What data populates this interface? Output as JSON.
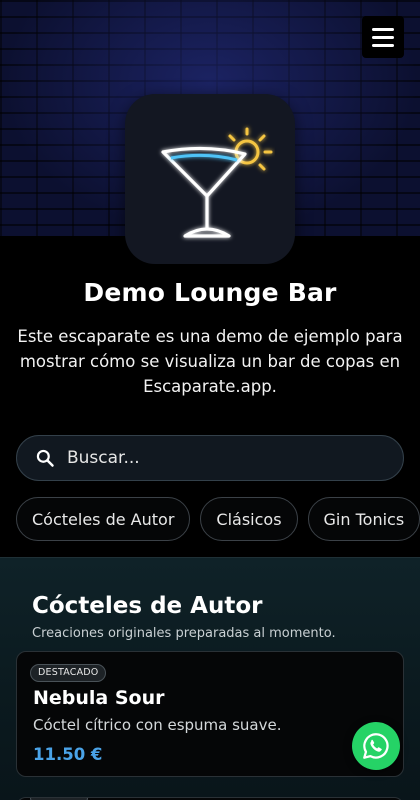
{
  "header": {
    "menu_icon": "hamburger-menu-icon",
    "logo_icon": "neon-cocktail-glass-icon"
  },
  "business": {
    "name": "Demo Lounge Bar",
    "description": "Este escaparate es una demo de ejemplo para mostrar cómo se visualiza un bar de copas en Escaparate.app."
  },
  "search": {
    "placeholder": "Buscar...",
    "icon": "search-icon"
  },
  "categories": [
    {
      "label": "Cócteles de Autor"
    },
    {
      "label": "Clásicos"
    },
    {
      "label": "Gin Tonics"
    }
  ],
  "section": {
    "title": "Cócteles de Autor",
    "subtitle": "Creaciones originales preparadas al momento."
  },
  "items": [
    {
      "badge": "DESTACADO",
      "name": "Nebula Sour",
      "description": "Cóctel cítrico con espuma suave.",
      "price": "11.50 €"
    }
  ],
  "floating": {
    "whatsapp_icon": "whatsapp-icon"
  },
  "colors": {
    "accent_price": "#4aa3e8",
    "whatsapp": "#25d366"
  }
}
